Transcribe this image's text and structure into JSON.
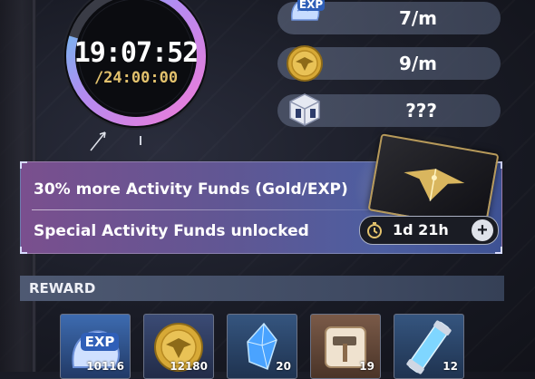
{
  "timer": {
    "elapsed": "19:07:52",
    "total": "/24:00:00",
    "progress_fraction": 0.797
  },
  "rates": [
    {
      "icon": "exp-icon",
      "label": "EXP",
      "value": "7/m"
    },
    {
      "icon": "gold-coin-icon",
      "value": "9/m"
    },
    {
      "icon": "mystery-box-icon",
      "value": "???"
    }
  ],
  "banner": {
    "line1": "30% more Activity Funds (Gold/EXP)",
    "line2": "Special Activity Funds unlocked",
    "duration": "1d 21h",
    "plus": "+"
  },
  "reward": {
    "header": "REWARD",
    "items": [
      {
        "icon": "exp-icon",
        "label": "EXP",
        "count": "10116",
        "rarity_color": "#2c4f8e"
      },
      {
        "icon": "gold-coin-icon",
        "count": "12180",
        "rarity_color": "#2d3e66"
      },
      {
        "icon": "blue-crystal-icon",
        "count": "20",
        "rarity_color": "#2d4a72"
      },
      {
        "icon": "hammer-icon",
        "count": "19",
        "rarity_color": "#6a4a3a"
      },
      {
        "icon": "cylinder-core-icon",
        "count": "12",
        "rarity_color": "#2d4a72"
      }
    ]
  },
  "colors": {
    "ring_gradient_start": "#f07bd8",
    "ring_gradient_end": "#5fc7ef",
    "gold_text": "#e3c26d"
  }
}
